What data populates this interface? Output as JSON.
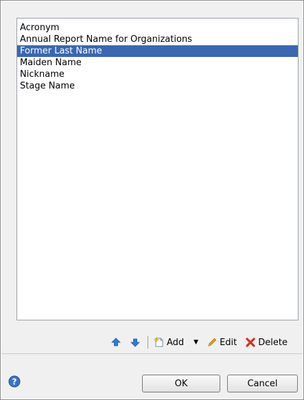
{
  "list": {
    "items": [
      {
        "label": "Acronym",
        "selected": false
      },
      {
        "label": "Annual Report Name for Organizations",
        "selected": false
      },
      {
        "label": "Former Last Name",
        "selected": true
      },
      {
        "label": "Maiden Name",
        "selected": false
      },
      {
        "label": "Nickname",
        "selected": false
      },
      {
        "label": "Stage Name",
        "selected": false
      }
    ],
    "selection_color": "#3a67b0"
  },
  "toolbar": {
    "move_up_icon": "arrow-up-icon",
    "move_down_icon": "arrow-down-icon",
    "add_label": "Add",
    "edit_label": "Edit",
    "delete_label": "Delete"
  },
  "footer": {
    "help_icon": "question-circle-icon",
    "ok_label": "OK",
    "cancel_label": "Cancel"
  }
}
